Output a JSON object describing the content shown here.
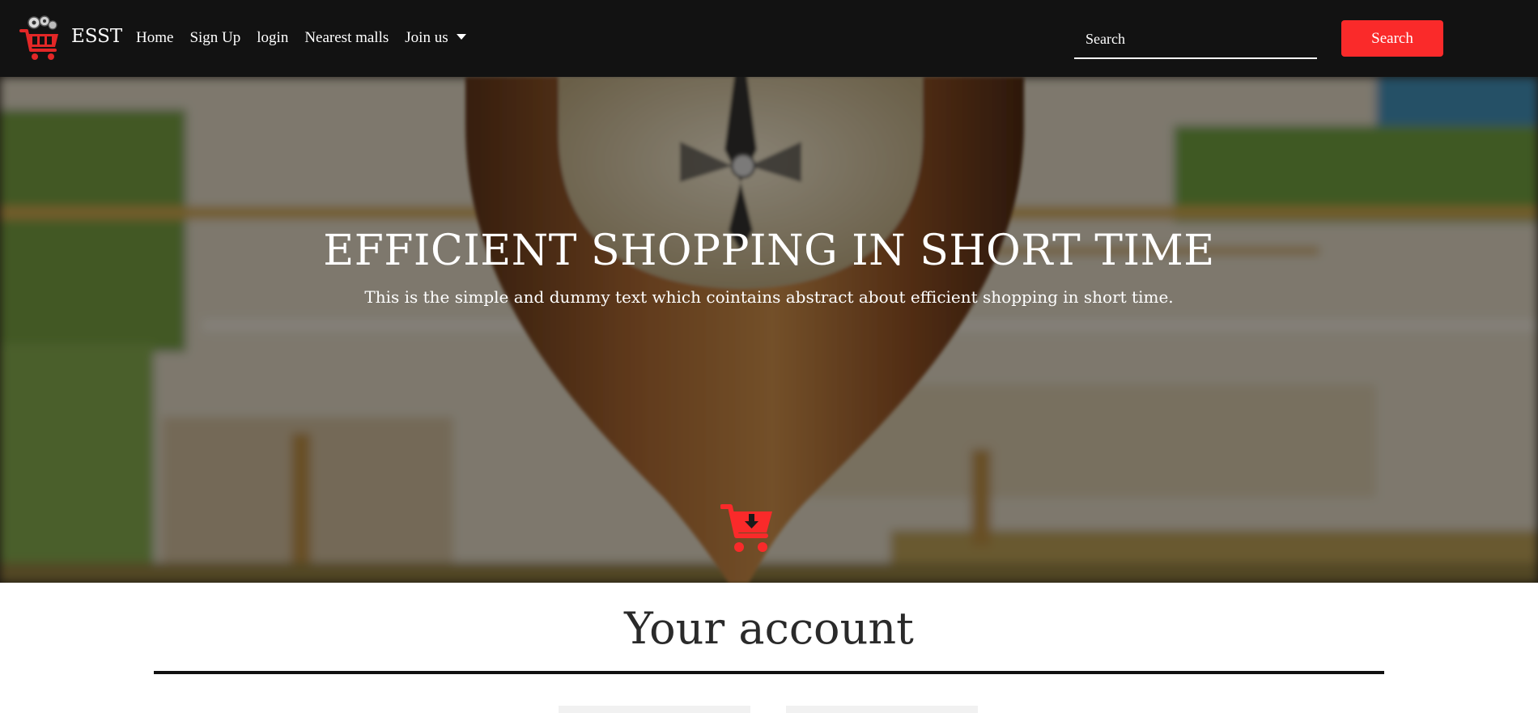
{
  "navbar": {
    "brand": "ESST",
    "links": [
      "Home",
      "Sign Up",
      "login",
      "Nearest malls"
    ],
    "dropdown_label": "Join us",
    "search_placeholder": "Search",
    "search_button": "Search"
  },
  "hero": {
    "title": "EFFICIENT SHOPPING IN SHORT TIME",
    "subtitle": "This is the simple and dummy text which cointains abstract about efficient shopping in short time.",
    "icon": "cart-download-icon"
  },
  "account": {
    "title": "Your account"
  },
  "colors": {
    "navbar_bg": "#121212",
    "accent": "#fa2a2a",
    "text_dark": "#2a2a2a"
  }
}
